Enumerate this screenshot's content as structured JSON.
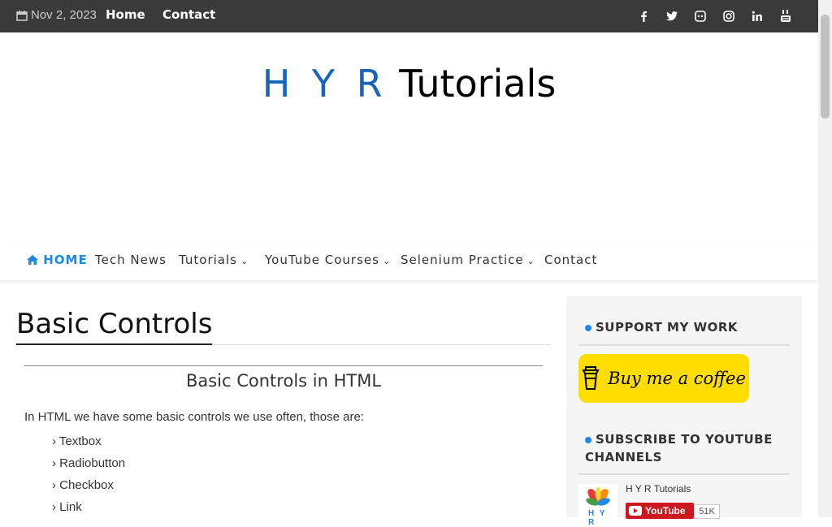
{
  "topbar": {
    "date": "Nov 2, 2023",
    "links": [
      "Home",
      "Contact"
    ],
    "social_icons": [
      "facebook-icon",
      "twitter-icon",
      "discord-icon",
      "instagram-icon",
      "linkedin-icon",
      "youtube-icon"
    ]
  },
  "logo": {
    "part1": "H Y R",
    "part2": "Tutorials"
  },
  "nav": {
    "home": "HOME",
    "tech_news": "Tech News",
    "tutorials": "Tutorials",
    "youtube_courses": "YouTube Courses",
    "selenium_practice": "Selenium Practice",
    "contact": "Contact"
  },
  "main": {
    "title": "Basic Controls",
    "subheading": "Basic Controls in HTML",
    "intro": "In HTML we have some basic controls we use often, those are:",
    "controls": [
      "Textbox",
      "Radiobutton",
      "Checkbox",
      "Link"
    ]
  },
  "sidebar": {
    "support_heading": "SUPPORT MY WORK",
    "coffee_label": "Buy me a coffee",
    "subscribe_heading_line1": "SUBSCRIBE TO YOUTUBE",
    "subscribe_heading_line2": "CHANNELS",
    "channel_name": "H Y R Tutorials",
    "youtube_button": "YouTube",
    "subscriber_count": "51K",
    "channel_logo_text": "H Y R"
  },
  "colors": {
    "accent": "#1e88e5",
    "logo_blue": "#1565c0",
    "topbar": "#3a3a3a",
    "coffee": "#ffdd00",
    "youtube_red": "#cc181e"
  }
}
